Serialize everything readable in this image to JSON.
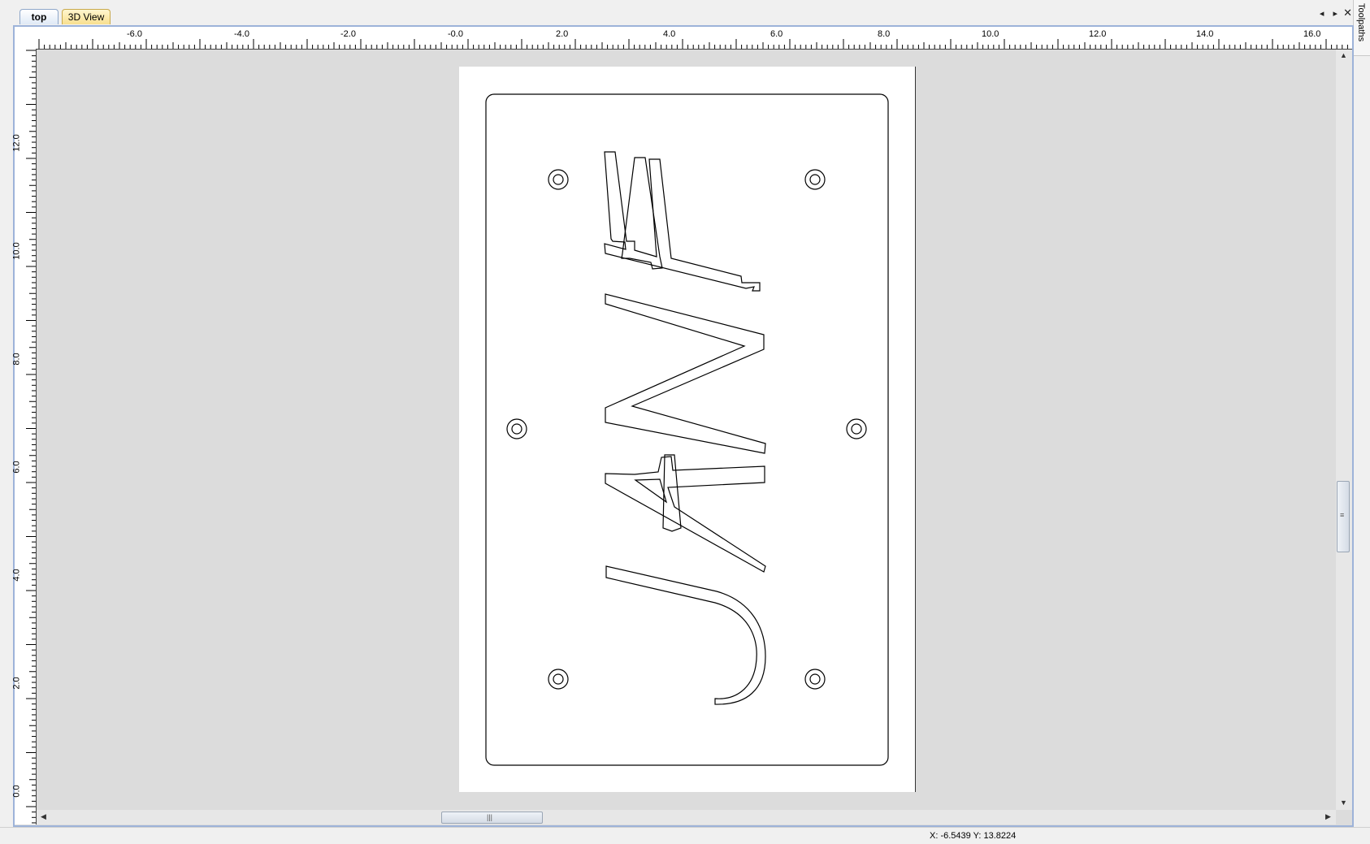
{
  "tabs": [
    {
      "label": "top",
      "active": true
    },
    {
      "label": "3D View",
      "active": false
    }
  ],
  "window_controls": {
    "nav_arrows": "◂ ▸",
    "close": "✕"
  },
  "side_panel": {
    "label": "Toolpaths"
  },
  "ruler": {
    "horizontal_labels": [
      "-6.0",
      "-4.0",
      "-2.0",
      "-0.0",
      "2.0",
      "4.0",
      "6.0",
      "8.0",
      "10.0",
      "12.0",
      "14.0",
      "16.0"
    ],
    "vertical_labels": [
      "12.0",
      "10.0",
      "8.0",
      "6.0",
      "4.0",
      "2.0",
      "0.0"
    ]
  },
  "scrollbar": {
    "grip": "|||",
    "grip_v": "≡"
  },
  "status": {
    "coordinates": "X: -6.5439 Y: 13.8224"
  },
  "drawing": {
    "text_shape": "JAVE",
    "hole_count": 6,
    "colors": {
      "canvas": "#dcdcdc",
      "page": "#ffffff",
      "stroke": "#000000",
      "frame": "#9db3d9"
    }
  }
}
